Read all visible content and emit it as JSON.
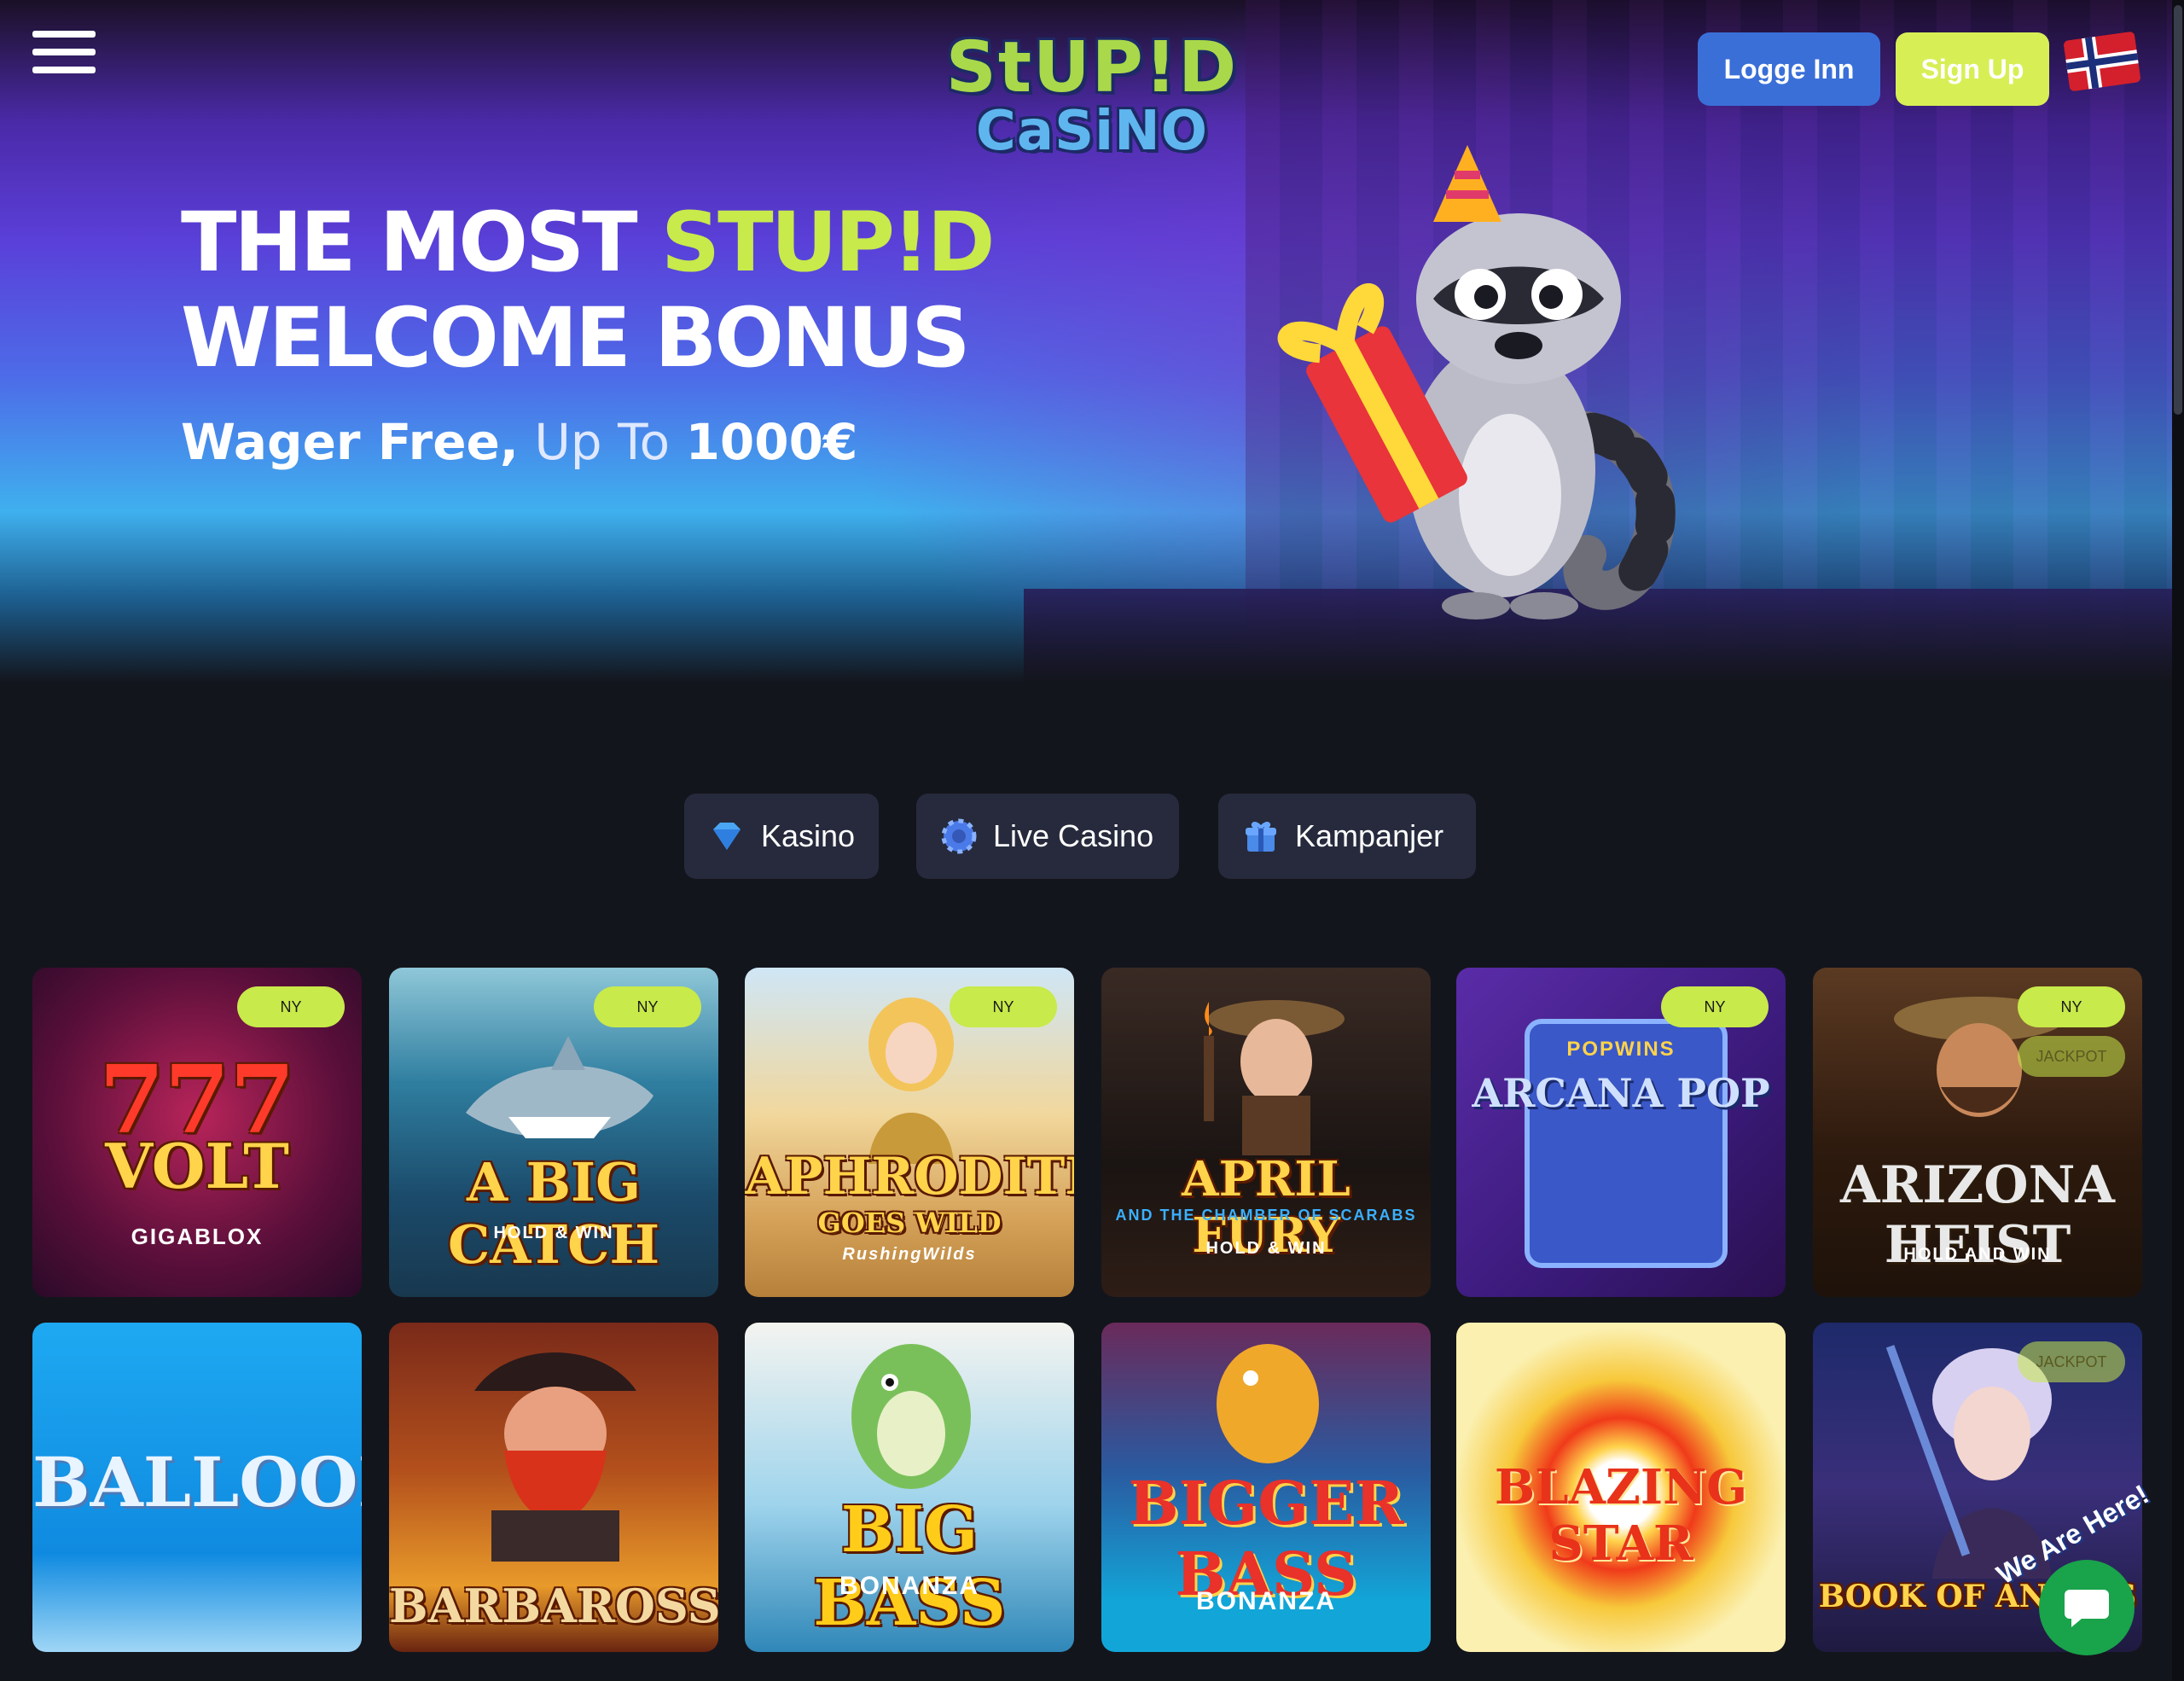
{
  "header": {
    "logo_line1": "StUP!D",
    "logo_line2": "CaSiNO",
    "login_label": "Logge Inn",
    "signup_label": "Sign Up"
  },
  "hero": {
    "line1_white": "THE MOST ",
    "line1_accent": "STUP!D",
    "line2": "WELCOME BONUS",
    "sub_bold": "Wager Free,",
    "sub_dim": " Up To ",
    "sub_amount": "1000€"
  },
  "tabs": [
    {
      "label": "Kasino",
      "icon": "diamond-icon"
    },
    {
      "label": "Live Casino",
      "icon": "chip-icon"
    },
    {
      "label": "Kampanjer",
      "icon": "gift-icon"
    }
  ],
  "games": [
    {
      "title": "VOLT",
      "top": "777",
      "sub": "GIGABLOX",
      "badge_new": "NY"
    },
    {
      "title": "A BIG CATCH",
      "sub": "HOLD & WIN",
      "badge_new": "NY"
    },
    {
      "title": "APHRODITE",
      "top": "GOES WILD",
      "sub": "RushingWilds",
      "badge_new": "NY"
    },
    {
      "title": "APRIL FURY",
      "top": "AND THE CHAMBER OF SCARABS",
      "sub": "HOLD & WIN"
    },
    {
      "title": "ARCANA POP",
      "top": "POPWINS",
      "badge_new": "NY"
    },
    {
      "title": "ARIZONA HEIST",
      "sub": "HOLD AND WIN",
      "badge_new": "NY",
      "badge_jackpot": "JACKPOT"
    },
    {
      "title": "BALLOON"
    },
    {
      "title": "BARBAROSSA"
    },
    {
      "title": "BIG BASS",
      "sub": "BONANZA"
    },
    {
      "title": "BIGGER BASS",
      "sub": "BONANZA"
    },
    {
      "title": "BLAZING STAR"
    },
    {
      "title": "BOOK OF ANUBIS",
      "badge_jackpot": "JACKPOT"
    }
  ],
  "chat": {
    "label": "We Are Here!"
  },
  "colors": {
    "accent": "#c8ea4a",
    "login": "#3a6fd8",
    "tab_bg": "#262a3c",
    "page_bg": "#13151c",
    "chat": "#19a34a"
  }
}
